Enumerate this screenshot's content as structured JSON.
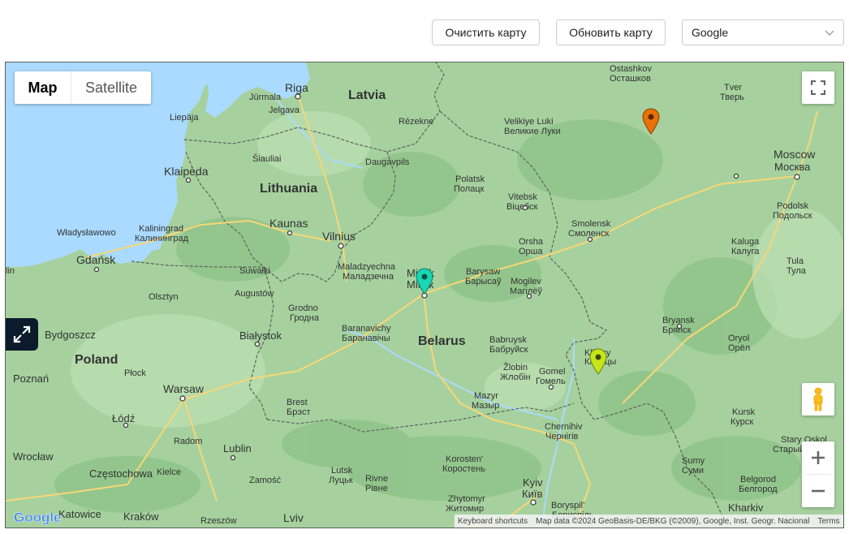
{
  "toolbar": {
    "clear_label": "Очистить карту",
    "refresh_label": "Обновить карту",
    "provider_select": "Google"
  },
  "map": {
    "map_type": {
      "map_label": "Map",
      "satellite_label": "Satellite",
      "selected": "Map"
    },
    "attribution": {
      "shortcuts": "Keyboard shortcuts",
      "data": "Map data ©2024 GeoBasis-DE/BKG (©2009), Google, Inst. Geogr. Nacional",
      "terms": "Terms"
    },
    "logo": "Google",
    "controls": [
      "fullscreen-icon",
      "pegman-icon",
      "zoom-in-icon",
      "zoom-out-icon",
      "expand-icon"
    ],
    "markers": [
      {
        "name": "marker-orange",
        "color": "#e8710a"
      },
      {
        "name": "marker-teal",
        "color": "#19d6b4"
      },
      {
        "name": "marker-lime",
        "color": "#c6e619"
      }
    ],
    "labels": {
      "riga": "Riga",
      "latvia": "Latvia",
      "jurmala": "Jūrmala",
      "jelgava": "Jelgava",
      "liepaja": "Liepāja",
      "rezekne": "Rēzekne",
      "daugavpils": "Daugavpils",
      "siauliai": "Šiauliai",
      "klaipeda": "Klaipėda",
      "lithuania": "Lithuania",
      "kaunas": "Kaunas",
      "vilnius": "Vilnius",
      "kaliningrad": "Kaliningrad",
      "kaliningrad_ru": "Калининград",
      "wladyslawowo": "Władysławowo",
      "gdansk": "Gdańsk",
      "elblag": "lin",
      "olsztyn": "Olsztyn",
      "suwalki": "Suwałki",
      "augustow": "Augustów",
      "grodno": "Grodno",
      "grodno_ru": "Гродна",
      "bialystok": "Białystok",
      "bydgoszcz": "Bydgoszcz",
      "poland": "Poland",
      "plock": "Płock",
      "poznan": "Poznań",
      "warsaw": "Warsaw",
      "lodz": "Łódź",
      "radom": "Radom",
      "wroclaw": "Wrocław",
      "czestochowa": "Częstochowa",
      "kielce": "Kielce",
      "lublin": "Lublin",
      "zamosc": "Zamość",
      "katowice": "Katowice",
      "krakow": "Kraków",
      "rzeszow": "Rzeszów",
      "lviv": "Lviv",
      "brest": "Brest",
      "brest_ru": "Брэст",
      "baranavichy": "Baranavichy",
      "baranavichy_ru": "Баранавічы",
      "belarus": "Belarus",
      "maladzyechna": "Maladzyechna",
      "maladzyechna_ru": "Маладзечна",
      "minsk": "Minsk",
      "minsk_ru": "Мінск",
      "barysaw": "Barysaw",
      "barysaw_ru": "Барысаў",
      "polatsk": "Polatsk",
      "polatsk_ru": "Полацк",
      "vitebsk": "Vitebsk",
      "vitebsk_ru": "Віцебск",
      "orsha": "Orsha",
      "orsha_ru": "Орша",
      "mogilev": "Mogilev",
      "mogilev_ru": "Магілёў",
      "babruysk": "Babruysk",
      "babruysk_ru": "Бабруйск",
      "zlobin": "Žlobin",
      "zlobin_ru": "Жлобін",
      "gomel": "Gomel",
      "gomel_ru": "Гомель",
      "mazyr": "Mazyr",
      "mazyr_ru": "Мазыр",
      "klintsy": "Klintsy",
      "klintsy_ru": "Клинцы",
      "chernihiv": "Chernihiv",
      "chernihiv_ru": "Чернігів",
      "korosten": "Korosten'",
      "korosten_ru": "Коростень",
      "lutsk": "Lutsk",
      "lutsk_ru": "Луцьк",
      "rivne": "Rivne",
      "rivne_ru": "Рівне",
      "zhytomyr": "Zhytomyr",
      "zhytomyr_ru": "Житомир",
      "kyiv": "Kyiv",
      "kyiv_ru": "Київ",
      "boryspil": "Boryspil'",
      "boryspil_ru": "Бориспіль",
      "velikie_luki": "Velikiye Luki",
      "velikie_luki_ru": "Великие Луки",
      "ostashkov": "Ostashkov",
      "ostashkov_ru": "Осташков",
      "tver": "Tver",
      "tver_ru": "Тверь",
      "moscow": "Moscow",
      "moscow_ru": "Москва",
      "podolsk": "Podolsk",
      "podolsk_ru": "Подольск",
      "smolensk": "Smolensk",
      "smolensk_ru": "Смоленск",
      "kaluga": "Kaluga",
      "kaluga_ru": "Калуга",
      "tula": "Tula",
      "tula_ru": "Тула",
      "bryansk": "Bryansk",
      "bryansk_ru": "Брянск",
      "oryol": "Oryol",
      "oryol_ru": "Орёл",
      "kursk": "Kursk",
      "kursk_ru": "Курск",
      "stary_oskol": "Stary Oskol",
      "stary_oskol_ru": "Старый Оскол",
      "sumy": "Sumy",
      "sumy_ru": "Суми",
      "belgorod": "Belgorod",
      "belgorod_ru": "Белгород",
      "kharkiv": "Kharkiv"
    }
  }
}
